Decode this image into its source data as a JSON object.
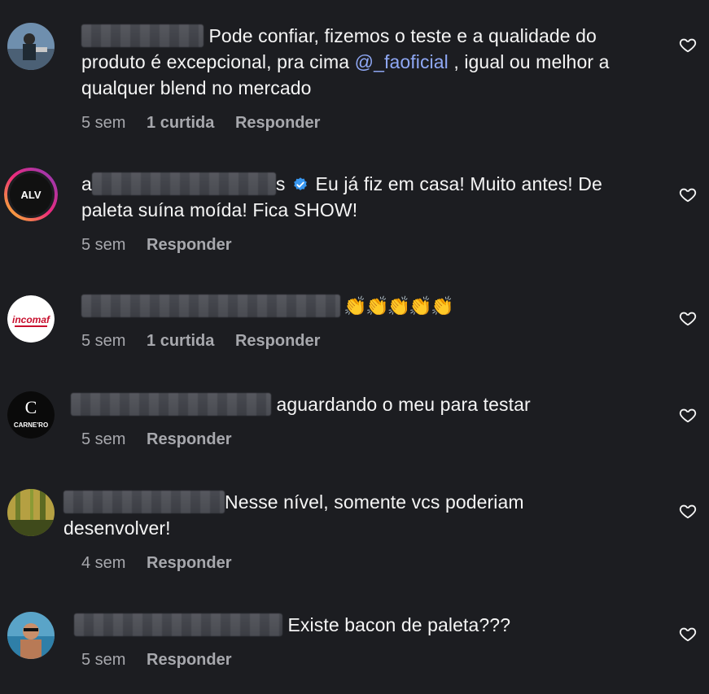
{
  "comments": [
    {
      "username_prefix": "",
      "username_suffix": "",
      "text_before": " Pode confiar, fizemos o teste e a qualidade do produto é excepcional, pra cima ",
      "mention": "@_faoficial",
      "text_after": " , igual ou melhor a qualquer blend no mercado",
      "time": "5 sem",
      "likes": "1 curtida",
      "reply": "Responder"
    },
    {
      "username_prefix": "a",
      "username_suffix": "s",
      "avatar_text": "ALV",
      "text": " Eu já fiz em casa! Muito antes! De paleta suína moída! Fica SHOW!",
      "time": "5 sem",
      "reply": "Responder"
    },
    {
      "avatar_text": "incomaf",
      "text": " 👏👏👏👏👏",
      "time": "5 sem",
      "likes": "1 curtida",
      "reply": "Responder"
    },
    {
      "avatar_text": "CARNE'RO",
      "text": " aguardando o meu para testar",
      "time": "5 sem",
      "reply": "Responder"
    },
    {
      "text": "Nesse nível, somente vcs poderiam desenvolver!",
      "time": "4 sem",
      "reply": "Responder"
    },
    {
      "text": " Existe bacon de paleta???",
      "time": "5 sem",
      "reply": "Responder"
    }
  ],
  "icons": {
    "like": "heart-outline-icon",
    "verified": "verified-badge-icon"
  },
  "colors": {
    "background": "#1c1d21",
    "text": "#f5f5f5",
    "meta": "#a7a8ad",
    "mention": "#8fa8f5",
    "verified": "#3897f0"
  }
}
